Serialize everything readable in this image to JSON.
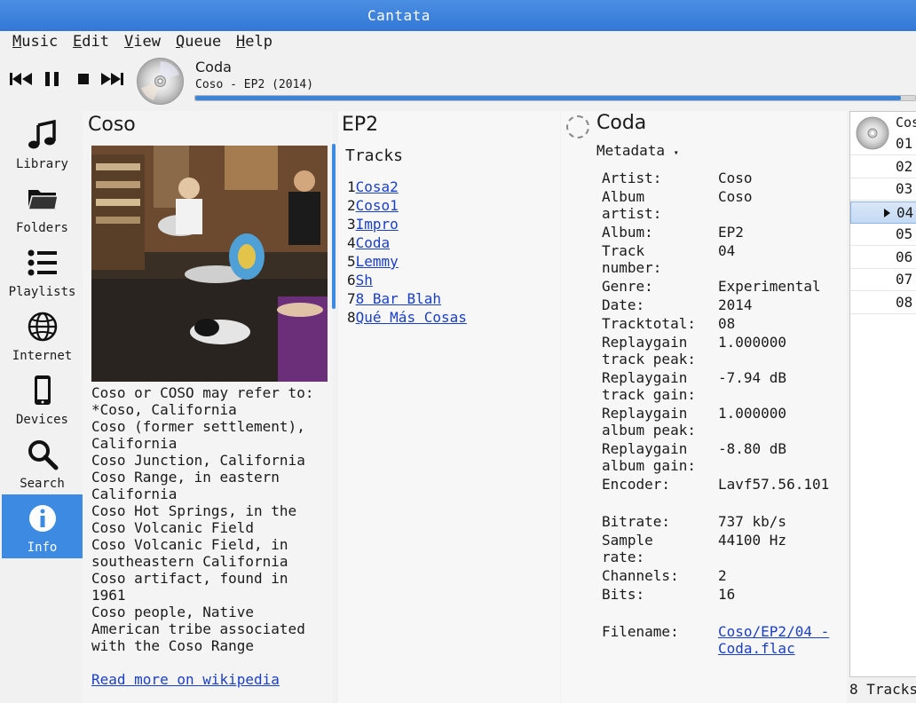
{
  "window": {
    "title": "Cantata"
  },
  "menu": [
    "Music",
    "Edit",
    "View",
    "Queue",
    "Help"
  ],
  "now_playing": {
    "title": "Coda",
    "subtitle": "Coso - EP2 (2014)",
    "progress": 0.98
  },
  "sidebar": {
    "items": [
      {
        "label": "Library",
        "icon": "music-note-icon"
      },
      {
        "label": "Folders",
        "icon": "folder-icon"
      },
      {
        "label": "Playlists",
        "icon": "list-icon"
      },
      {
        "label": "Internet",
        "icon": "globe-icon"
      },
      {
        "label": "Devices",
        "icon": "phone-icon"
      },
      {
        "label": "Search",
        "icon": "search-icon"
      },
      {
        "label": "Info",
        "icon": "info-icon",
        "active": true
      }
    ]
  },
  "artist": {
    "name": "Coso",
    "bio": "Coso or COSO may refer to:\n*Coso, California\nCoso (former settlement),\nCalifornia\nCoso Junction, California\nCoso Range, in eastern\nCalifornia\nCoso Hot Springs, in the\nCoso Volcanic Field\nCoso Volcanic Field, in\nsoutheastern California\nCoso artifact, found in\n1961\nCoso people, Native\nAmerican tribe associated\nwith the Coso Range",
    "wiki_link": "Read more on wikipedia"
  },
  "album": {
    "name": "EP2",
    "tracks_label": "Tracks",
    "tracks": [
      {
        "num": "1",
        "title": "Cosa2"
      },
      {
        "num": "2",
        "title": "Coso1"
      },
      {
        "num": "3",
        "title": "Impro"
      },
      {
        "num": "4",
        "title": "Coda"
      },
      {
        "num": "5",
        "title": "Lemmy"
      },
      {
        "num": "6",
        "title": "Sh"
      },
      {
        "num": "7",
        "title": "8 Bar Blah"
      },
      {
        "num": "8",
        "title": "Qué Más Cosas"
      }
    ]
  },
  "song": {
    "title": "Coda",
    "view": "Metadata",
    "metadata": [
      {
        "key": "Artist:",
        "value": "Coso"
      },
      {
        "key": "Album\nartist:",
        "value": "Coso"
      },
      {
        "key": "Album:",
        "value": "EP2"
      },
      {
        "key": "Track\nnumber:",
        "value": "04"
      },
      {
        "key": "Genre:",
        "value": "Experimental"
      },
      {
        "key": "Date:",
        "value": "2014"
      },
      {
        "key": "Tracktotal:",
        "value": "08"
      },
      {
        "key": "Replaygain\ntrack peak:",
        "value": "1.000000"
      },
      {
        "key": "Replaygain\ntrack gain:",
        "value": "-7.94 dB"
      },
      {
        "key": "Replaygain\nalbum peak:",
        "value": "1.000000"
      },
      {
        "key": "Replaygain\nalbum gain:",
        "value": "-8.80 dB"
      },
      {
        "key": "Encoder:",
        "value": "Lavf57.56.101"
      },
      {
        "key": "",
        "value": ""
      },
      {
        "key": "Bitrate:",
        "value": "737 kb/s"
      },
      {
        "key": "Sample\nrate:",
        "value": "44100 Hz"
      },
      {
        "key": "Channels:",
        "value": "2"
      },
      {
        "key": "Bits:",
        "value": "16"
      },
      {
        "key": "",
        "value": ""
      },
      {
        "key": "Filename:",
        "value": "Coso/EP2/04 -\nCoda.flac",
        "link": true
      }
    ]
  },
  "queue": {
    "artist": "Coso",
    "rows": [
      "01",
      "02",
      "03",
      "04",
      "05",
      "06",
      "07",
      "08"
    ],
    "current_index": 3,
    "count": "8 Tracks"
  }
}
